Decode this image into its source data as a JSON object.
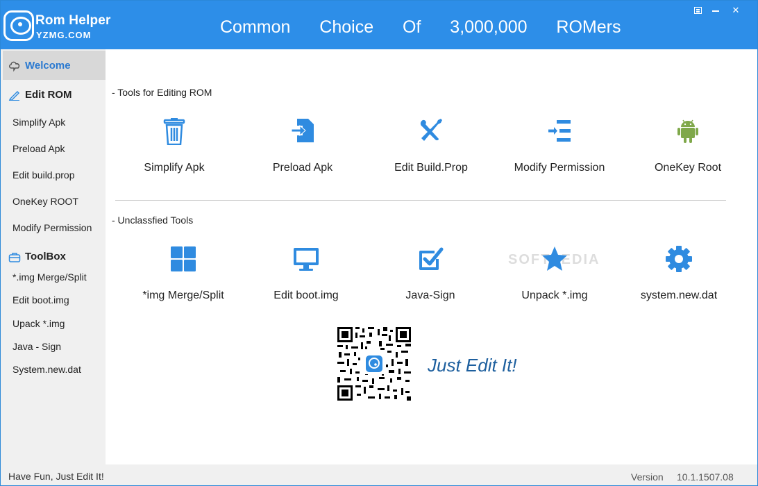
{
  "app": {
    "brand_name": "Rom Helper",
    "brand_sub": "YZMG.COM",
    "headline": "Common  Choice  Of  3,000,000  ROMers"
  },
  "sidebar": {
    "welcome": "Welcome",
    "edit_rom": {
      "label": "Edit ROM",
      "items": [
        "Simplify Apk",
        "Preload Apk",
        "Edit build.prop",
        "OneKey ROOT",
        "Modify Permission"
      ]
    },
    "toolbox": {
      "label": "ToolBox",
      "items": [
        "*.img Merge/Split",
        "Edit boot.img",
        "Upack  *.img",
        "Java - Sign",
        "System.new.dat"
      ]
    }
  },
  "main": {
    "editing_title": "- Tools for Editing ROM",
    "editing_tools": [
      {
        "label": "Simplify Apk",
        "icon": "trash-icon"
      },
      {
        "label": "Preload Apk",
        "icon": "file-import-icon"
      },
      {
        "label": "Edit Build.Prop",
        "icon": "tools-icon"
      },
      {
        "label": "Modify Permission",
        "icon": "indent-list-icon"
      },
      {
        "label": "OneKey Root",
        "icon": "android-icon"
      }
    ],
    "unclassified_title": "- Unclassfied Tools",
    "unclassified_tools": [
      {
        "label": "*img Merge/Split",
        "icon": "grid-icon"
      },
      {
        "label": "Edit boot.img",
        "icon": "monitor-icon"
      },
      {
        "label": "Java-Sign",
        "icon": "checkbox-icon"
      },
      {
        "label": "Unpack *.img",
        "icon": "star-icon"
      },
      {
        "label": "system.new.dat",
        "icon": "gear-icon"
      }
    ],
    "tagline": "Just Edit It!",
    "watermark": "SOFTPEDIA"
  },
  "status": {
    "left": "Have Fun, Just Edit It!",
    "version_label": "Version",
    "version": "10.1.1507.08"
  },
  "colors": {
    "accent": "#2d8ee8",
    "icon_blue": "#2f8be0",
    "android_green": "#7fa84a",
    "tagline": "#1d5f9e"
  }
}
